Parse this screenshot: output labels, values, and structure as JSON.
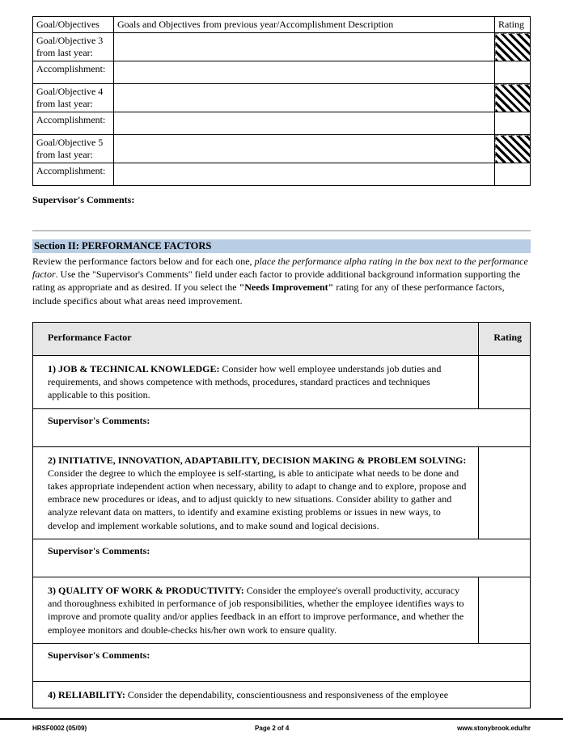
{
  "goals_header": {
    "col1": "Goal/Objectives",
    "col2": "Goals and Objectives from previous year/Accomplishment Description",
    "col3": "Rating"
  },
  "goals": [
    {
      "label": "Goal/Objective 3 from last year:",
      "accLabel": "Accomplishment:"
    },
    {
      "label": "Goal/Objective 4 from last year:",
      "accLabel": "Accomplishment:"
    },
    {
      "label": "Goal/Objective 5 from last year:",
      "accLabel": "Accomplishment:"
    }
  ],
  "supervisor_comments_label": "Supervisor's Comments:",
  "section2": {
    "header": "Section II:  PERFORMANCE FACTORS",
    "intro_plain1": "Review the performance factors below and for each one, ",
    "intro_italic": "place the performance alpha rating in the box next to the performance factor",
    "intro_plain2": ".  Use the \"Supervisor's Comments\" field under each factor to provide additional background information supporting the rating as appropriate and as desired.  If you select the ",
    "intro_bold": "\"Needs Improvement\"",
    "intro_plain3": " rating for any of these performance factors, include specifics about what areas need improvement."
  },
  "pf_header": {
    "factor": "Performance Factor",
    "rating": "Rating"
  },
  "pf_comments_label": "Supervisor's Comments:",
  "factors": [
    {
      "title": "1) JOB & TECHNICAL KNOWLEDGE:  ",
      "desc": "Consider how well employee understands job duties and requirements, and shows competence with methods, procedures, standard practices and techniques applicable to this position."
    },
    {
      "title": "2) INITIATIVE, INNOVATION, ADAPTABILITY, DECISION MAKING & PROBLEM SOLVING: ",
      "desc": "Consider the degree to which the employee is self-starting, is able to anticipate what needs to be done and takes appropriate independent action when necessary, ability to adapt to change and to explore, propose and embrace new procedures or ideas, and to adjust quickly to new situations. Consider ability to gather and analyze relevant data on matters, to identify and examine existing problems or issues in new ways, to develop and implement workable solutions, and to make sound and logical decisions."
    },
    {
      "title": "3) QUALITY OF WORK & PRODUCTIVITY: ",
      "desc": "Consider the employee's overall productivity, accuracy and thoroughness exhibited in performance of job responsibilities, whether the employee identifies ways to improve and promote quality and/or applies feedback in an effort to improve performance, and whether the employee monitors and double-checks his/her own work to ensure quality."
    },
    {
      "title": "4) RELIABILITY:  ",
      "desc": "Consider the dependability, conscientiousness and responsiveness of the employee"
    }
  ],
  "footer": {
    "left": "HRSF0002  (05/09)",
    "center": "Page 2 of 4",
    "right": "www.stonybrook.edu/hr"
  }
}
